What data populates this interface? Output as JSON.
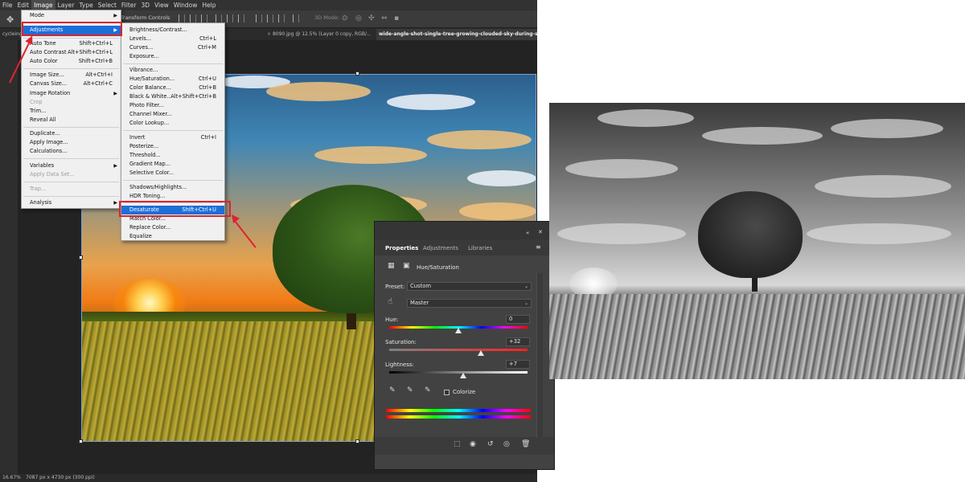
{
  "menubar": {
    "items": [
      "File",
      "Edit",
      "Image",
      "Layer",
      "Type",
      "Select",
      "Filter",
      "3D",
      "View",
      "Window",
      "Help"
    ]
  },
  "optionsbar": {
    "transform_label": "Transform Controls",
    "mode3d_label": "3D Mode:"
  },
  "tabs": [
    {
      "label": "cycleing",
      "active": false
    },
    {
      "label": "8090.jpg @ 12.5% (Layer 0 copy, RGB/...",
      "active": false
    },
    {
      "label": "wide-angle-shot-single-tree-growing-clouded-sky-during-sunset",
      "active": true
    }
  ],
  "image_menu": {
    "items": [
      {
        "label": "Mode",
        "shortcut": "",
        "submenu": true,
        "disabled": false
      },
      {
        "label": "Adjustments",
        "shortcut": "",
        "submenu": true,
        "disabled": false,
        "highlighted": true
      },
      {
        "label": "Auto Tone",
        "shortcut": "Shift+Ctrl+L",
        "submenu": false,
        "disabled": false
      },
      {
        "label": "Auto Contrast",
        "shortcut": "Alt+Shift+Ctrl+L",
        "submenu": false,
        "disabled": false
      },
      {
        "label": "Auto Color",
        "shortcut": "Shift+Ctrl+B",
        "submenu": false,
        "disabled": false
      },
      {
        "label": "Image Size...",
        "shortcut": "Alt+Ctrl+I",
        "submenu": false,
        "disabled": false
      },
      {
        "label": "Canvas Size...",
        "shortcut": "Alt+Ctrl+C",
        "submenu": false,
        "disabled": false
      },
      {
        "label": "Image Rotation",
        "shortcut": "",
        "submenu": true,
        "disabled": false
      },
      {
        "label": "Crop",
        "shortcut": "",
        "submenu": false,
        "disabled": true
      },
      {
        "label": "Trim...",
        "shortcut": "",
        "submenu": false,
        "disabled": false
      },
      {
        "label": "Reveal All",
        "shortcut": "",
        "submenu": false,
        "disabled": false
      },
      {
        "label": "Duplicate...",
        "shortcut": "",
        "submenu": false,
        "disabled": false
      },
      {
        "label": "Apply Image...",
        "shortcut": "",
        "submenu": false,
        "disabled": false
      },
      {
        "label": "Calculations...",
        "shortcut": "",
        "submenu": false,
        "disabled": false
      },
      {
        "label": "Variables",
        "shortcut": "",
        "submenu": true,
        "disabled": false
      },
      {
        "label": "Apply Data Set...",
        "shortcut": "",
        "submenu": false,
        "disabled": true
      },
      {
        "label": "Trap...",
        "shortcut": "",
        "submenu": false,
        "disabled": true
      },
      {
        "label": "Analysis",
        "shortcut": "",
        "submenu": true,
        "disabled": false
      }
    ]
  },
  "adjust_menu": {
    "items": [
      {
        "label": "Brightness/Contrast...",
        "shortcut": ""
      },
      {
        "label": "Levels...",
        "shortcut": "Ctrl+L"
      },
      {
        "label": "Curves...",
        "shortcut": "Ctrl+M"
      },
      {
        "label": "Exposure...",
        "shortcut": ""
      },
      {
        "label": "Vibrance...",
        "shortcut": ""
      },
      {
        "label": "Hue/Saturation...",
        "shortcut": "Ctrl+U"
      },
      {
        "label": "Color Balance...",
        "shortcut": "Ctrl+B"
      },
      {
        "label": "Black & White...",
        "shortcut": "Alt+Shift+Ctrl+B"
      },
      {
        "label": "Photo Filter...",
        "shortcut": ""
      },
      {
        "label": "Channel Mixer...",
        "shortcut": ""
      },
      {
        "label": "Color Lookup...",
        "shortcut": ""
      },
      {
        "label": "Invert",
        "shortcut": "Ctrl+I"
      },
      {
        "label": "Posterize...",
        "shortcut": ""
      },
      {
        "label": "Threshold...",
        "shortcut": ""
      },
      {
        "label": "Gradient Map...",
        "shortcut": ""
      },
      {
        "label": "Selective Color...",
        "shortcut": ""
      },
      {
        "label": "Shadows/Highlights...",
        "shortcut": ""
      },
      {
        "label": "HDR Toning...",
        "shortcut": ""
      },
      {
        "label": "Desaturate",
        "shortcut": "Shift+Ctrl+U",
        "highlighted": true
      },
      {
        "label": "Match Color...",
        "shortcut": ""
      },
      {
        "label": "Replace Color...",
        "shortcut": ""
      },
      {
        "label": "Equalize",
        "shortcut": ""
      }
    ]
  },
  "properties": {
    "tabs": [
      "Properties",
      "Adjustments",
      "Libraries"
    ],
    "title": "Hue/Saturation",
    "preset_label": "Preset:",
    "preset_value": "Custom",
    "channel_value": "Master",
    "hue_label": "Hue:",
    "hue_value": "0",
    "saturation_label": "Saturation:",
    "saturation_value": "+32",
    "lightness_label": "Lightness:",
    "lightness_value": "+7",
    "colorize_label": "Colorize"
  },
  "slider_levels": {
    "hue": 0.5,
    "saturation": 0.66,
    "lightness": 0.535
  },
  "status": {
    "zoom": "16.67%",
    "doc_info": "7087 px x 4730 px (300 ppi)"
  },
  "colors": {
    "highlight": "#1d6fd8",
    "annotation_red": "#e0232d"
  }
}
